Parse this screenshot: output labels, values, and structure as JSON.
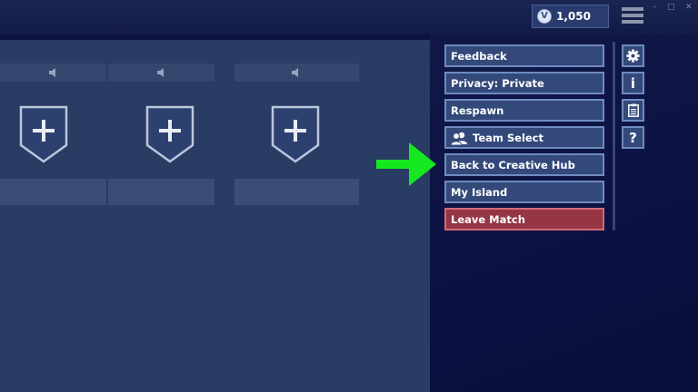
{
  "topbar": {
    "vbucks_symbol": "V",
    "vbucks_amount": "1,050",
    "menu_icon": "hamburger-menu-icon",
    "window_controls": [
      "–",
      "□",
      "✕"
    ]
  },
  "party_slots": [
    {
      "speaker_icon": "speaker-icon",
      "add_icon": "plus-icon"
    },
    {
      "speaker_icon": "speaker-icon",
      "add_icon": "plus-icon"
    },
    {
      "speaker_icon": "speaker-icon",
      "add_icon": "plus-icon"
    }
  ],
  "menu": {
    "feedback": "Feedback",
    "privacy": "Privacy: Private",
    "respawn": "Respawn",
    "team_select": "Team Select",
    "back_to_hub": "Back to Creative Hub",
    "my_island": "My Island",
    "leave_match": "Leave Match"
  },
  "side_icons": {
    "settings": "gear-icon",
    "info": "i",
    "clipboard": "clipboard-icon",
    "help": "?"
  },
  "annotation": {
    "pointer": "green-arrow-icon"
  },
  "colors": {
    "accent_button": "#33497a",
    "button_border": "#6f8bc0",
    "leave_button": "#963645",
    "arrow": "#16e81f",
    "panel": "#293c64"
  }
}
